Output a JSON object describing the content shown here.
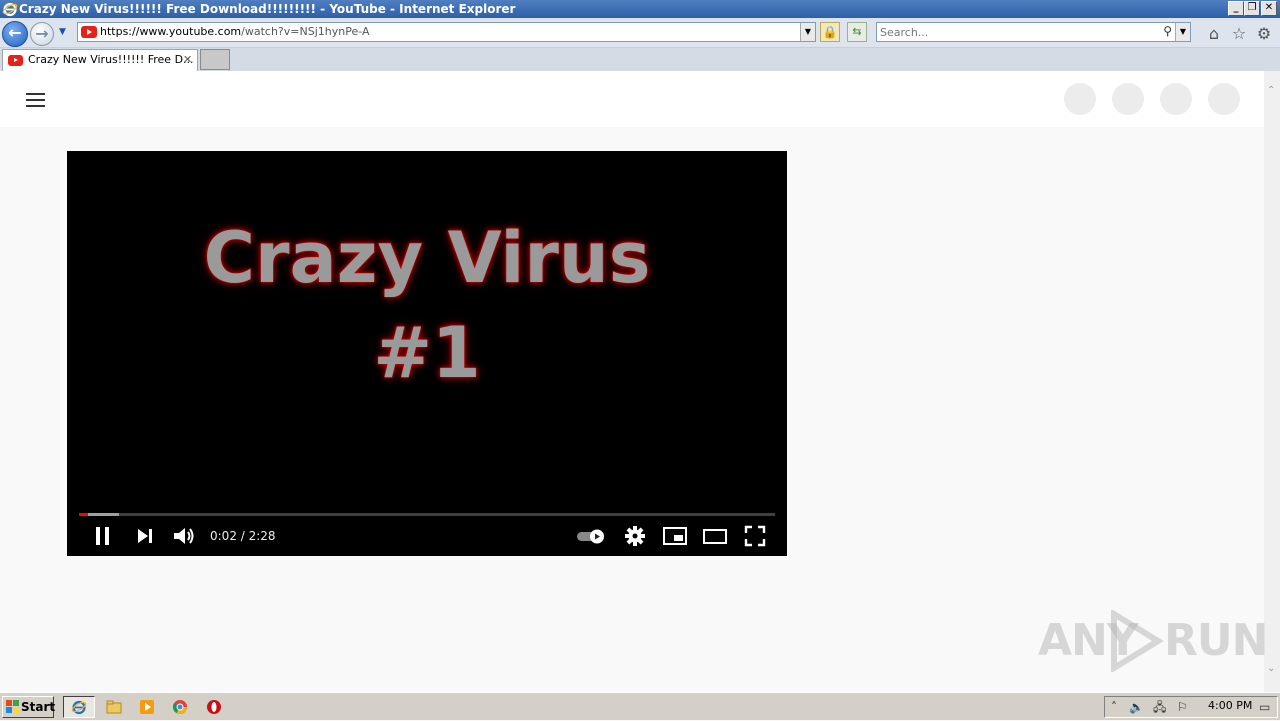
{
  "window": {
    "title": "Crazy New Virus!!!!!! Free Download!!!!!!!!! - YouTube - Internet Explorer",
    "min_glyph": "_",
    "max_glyph": "❐",
    "close_glyph": "✕"
  },
  "address_bar": {
    "url_prefix": "https://",
    "url_host": "www.youtube.com",
    "url_path": "/watch?v=NSj1hynPe-A"
  },
  "search": {
    "placeholder": "Search..."
  },
  "tab": {
    "title": "Crazy New Virus!!!!!! Free D...",
    "close": "✕"
  },
  "video": {
    "overlay_line1": "Crazy Virus",
    "overlay_line2": "#1",
    "current_time": "0:02",
    "duration": "2:28",
    "time_display": "0:02 / 2:28",
    "progress_fraction": 0.0135,
    "buffered_fraction": 0.058
  },
  "watermark": {
    "left": "ANY",
    "right": "RUN"
  },
  "taskbar": {
    "start_label": "Start",
    "clock": "4:00 PM"
  },
  "colors": {
    "youtube_red": "#e62117",
    "progress_red": "#ff0000",
    "titlebar_blue": "#2d5fa8"
  }
}
